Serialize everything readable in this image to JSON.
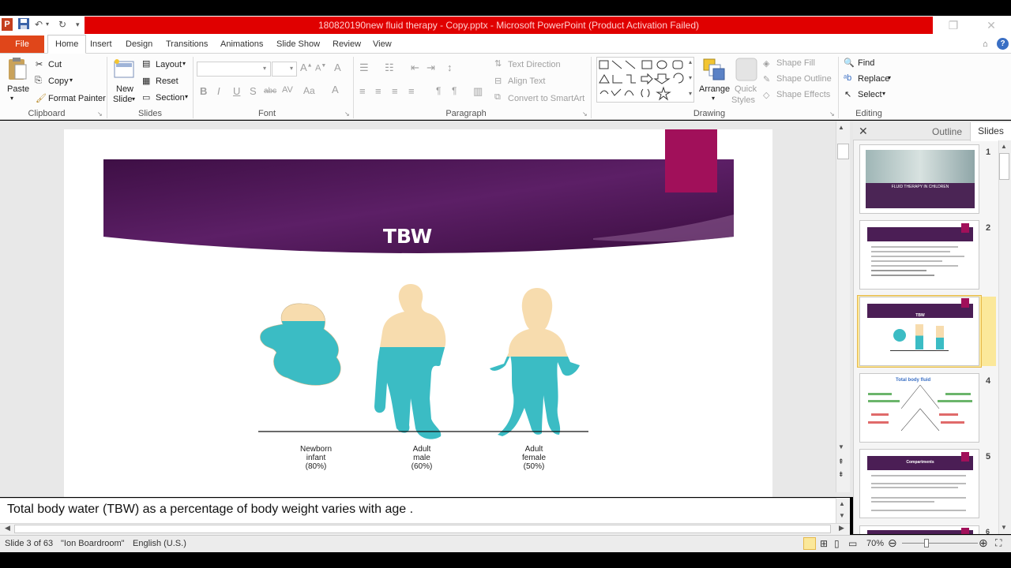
{
  "window": {
    "title": "180820190new fluid therapy  - Copy.pptx  -  Microsoft PowerPoint (Product Activation Failed)"
  },
  "ribbon_tabs": [
    "Home",
    "Insert",
    "Design",
    "Transitions",
    "Animations",
    "Slide Show",
    "Review",
    "View"
  ],
  "file_tab": "File",
  "clipboard": {
    "paste": "Paste",
    "cut": "Cut",
    "copy": "Copy",
    "format_painter": "Format Painter",
    "label": "Clipboard"
  },
  "slides_group": {
    "new_slide_1": "New",
    "new_slide_2": "Slide",
    "layout": "Layout",
    "reset": "Reset",
    "section": "Section",
    "label": "Slides"
  },
  "font_group": {
    "label": "Font"
  },
  "paragraph_group": {
    "text_direction": "Text Direction",
    "align_text": "Align Text",
    "convert_smartart": "Convert to SmartArt",
    "label": "Paragraph"
  },
  "drawing_group": {
    "arrange": "Arrange",
    "quick_styles_1": "Quick",
    "quick_styles_2": "Styles",
    "shape_fill": "Shape Fill",
    "shape_outline": "Shape Outline",
    "shape_effects": "Shape Effects",
    "label": "Drawing"
  },
  "editing_group": {
    "find": "Find",
    "replace": "Replace",
    "select": "Select",
    "label": "Editing"
  },
  "pane": {
    "outline_tab": "Outline",
    "slides_tab": "Slides"
  },
  "slide": {
    "title": "TBW",
    "figures": [
      {
        "line1": "Newborn",
        "line2": "infant",
        "line3": "(80%)"
      },
      {
        "line1": "Adult",
        "line2": "male",
        "line3": "(60%)"
      },
      {
        "line1": "Adult",
        "line2": "female",
        "line3": "(50%)"
      }
    ]
  },
  "thumbnails": [
    {
      "num": "1",
      "caption": "FLUID THERAPY  IN CHILDREN"
    },
    {
      "num": "2"
    },
    {
      "num": "3",
      "caption": "TBW"
    },
    {
      "num": "4",
      "caption": "Total body fluid"
    },
    {
      "num": "5",
      "caption": "Compartments"
    },
    {
      "num": "6"
    }
  ],
  "notes": "Total body water (TBW) as a percentage of body weight varies with age .",
  "status": {
    "slide_info": "Slide 3 of 63",
    "theme": "\"Ion Boardroom\"",
    "language": "English (U.S.)",
    "zoom": "70%"
  },
  "colors": {
    "banner": "#5a1a5e",
    "accent": "#a1105a",
    "body_water": "#3bbcc4",
    "skin": "#f7dcae",
    "title_bar": "#e00000",
    "file_tab": "#e0461a"
  },
  "current_slide_index": 3
}
